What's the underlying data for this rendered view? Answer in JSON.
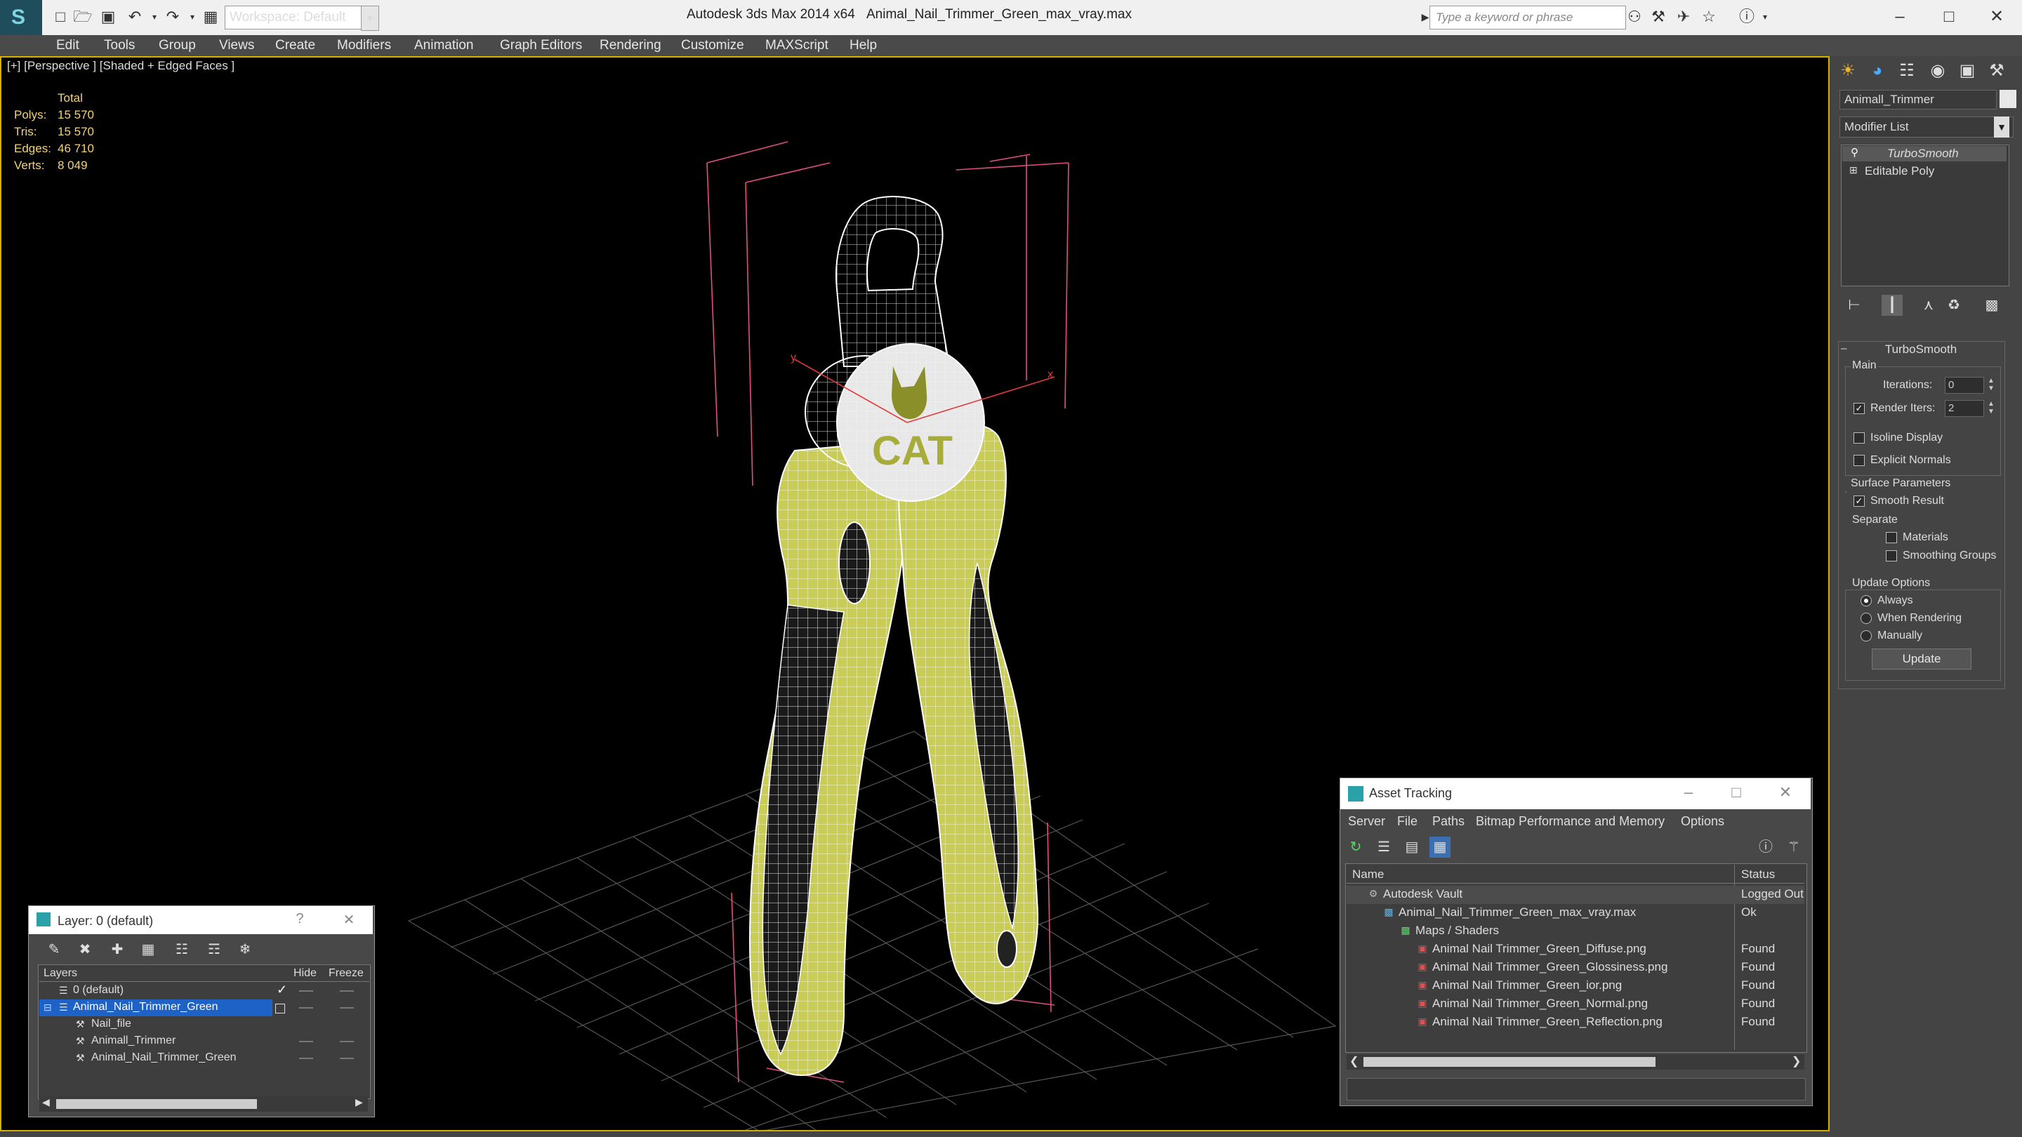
{
  "titlebar": {
    "workspace": "Workspace: Default",
    "app_title": "Autodesk 3ds Max  2014 x64",
    "file_title": "Animal_Nail_Trimmer_Green_max_vray.max",
    "search_placeholder": "Type a keyword or phrase"
  },
  "menu": [
    "Edit",
    "Tools",
    "Group",
    "Views",
    "Create",
    "Modifiers",
    "Animation",
    "Graph Editors",
    "Rendering",
    "Customize",
    "MAXScript",
    "Help"
  ],
  "viewport": {
    "label": "[+] [Perspective ] [Shaded + Edged Faces ]",
    "stats": {
      "header": "Total",
      "rows": [
        {
          "label": "Polys:",
          "value": "15 570"
        },
        {
          "label": "Tris:",
          "value": "15 570"
        },
        {
          "label": "Edges:",
          "value": "46 710"
        },
        {
          "label": "Verts:",
          "value": "8 049"
        }
      ]
    },
    "logo_text": "CAT",
    "axis_x": "x",
    "axis_y": "y"
  },
  "command_panel": {
    "object_name": "Animall_Trimmer",
    "modifier_list": "Modifier List",
    "stack": [
      "TurboSmooth",
      "Editable Poly"
    ],
    "rollout_title": "TurboSmooth",
    "main_group": "Main",
    "iterations_label": "Iterations:",
    "iterations_value": "0",
    "render_iters_label": "Render Iters:",
    "render_iters_value": "2",
    "isoline_display": "Isoline Display",
    "explicit_normals": "Explicit Normals",
    "surface_params": "Surface Parameters",
    "smooth_result": "Smooth Result",
    "separate": "Separate",
    "materials": "Materials",
    "smoothing_groups": "Smoothing Groups",
    "update_options": "Update Options",
    "always": "Always",
    "when_rendering": "When Rendering",
    "manually": "Manually",
    "update_button": "Update"
  },
  "layer_window": {
    "title": "Layer: 0 (default)",
    "columns": [
      "Layers",
      "Hide",
      "Freeze"
    ],
    "rows": [
      "0 (default)",
      "Animal_Nail_Trimmer_Green",
      "Nail_file",
      "Animall_Trimmer",
      "Animal_Nail_Trimmer_Green"
    ]
  },
  "asset_window": {
    "title": "Asset Tracking",
    "menu": [
      "Server",
      "File",
      "Paths",
      "Bitmap Performance and Memory",
      "Options"
    ],
    "columns": [
      "Name",
      "Status"
    ],
    "rows": [
      {
        "name": "Autodesk Vault",
        "status": "Logged Out"
      },
      {
        "name": "Animal_Nail_Trimmer_Green_max_vray.max",
        "status": "Ok"
      },
      {
        "name": "Maps / Shaders",
        "status": ""
      },
      {
        "name": "Animal Nail Trimmer_Green_Diffuse.png",
        "status": "Found"
      },
      {
        "name": "Animal Nail Trimmer_Green_Glossiness.png",
        "status": "Found"
      },
      {
        "name": "Animal Nail Trimmer_Green_ior.png",
        "status": "Found"
      },
      {
        "name": "Animal Nail Trimmer_Green_Normal.png",
        "status": "Found"
      },
      {
        "name": "Animal Nail Trimmer_Green_Reflection.png",
        "status": "Found"
      }
    ]
  },
  "colors": {
    "viewport_border": "#d4b000",
    "selection": "#1e62c8",
    "mesh_green": "#c9cc55",
    "stats": "#f2d27a"
  }
}
